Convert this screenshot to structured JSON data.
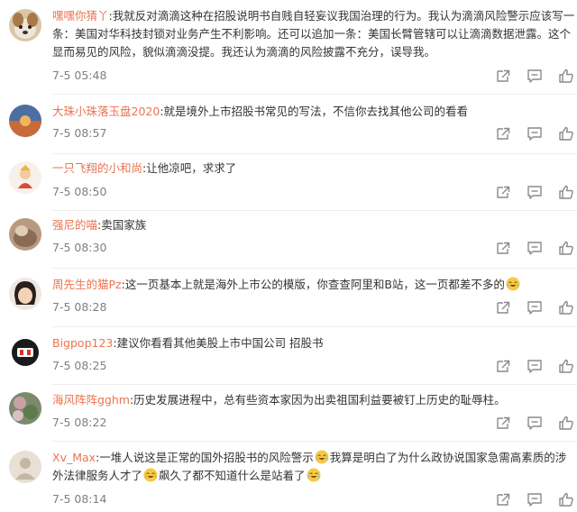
{
  "comments": [
    {
      "username": "嘿嘿你猜丫",
      "lines": [
        ":我就反对滴滴这种在招股说明书自贱自轻妄议我国治理的行为。我认为滴滴风险警示应该写一",
        "条：美国对华科技封锁对业务产生不利影响。还可以追加一条：美国长臂管辖可以让滴滴数据泄露。这个",
        "显而易见的风险，貌似滴滴没提。我还认为滴滴的风险披露不充分，误导我。"
      ],
      "time": "7-5 05:48"
    },
    {
      "username": "大珠小珠落玉盘2020",
      "text": ":就是境外上市招股书常见的写法，不信你去找其他公司的看看",
      "time": "7-5 08:57"
    },
    {
      "username": "一只飞翔的小和尚",
      "text": ":让他凉吧，求求了",
      "time": "7-5 08:50"
    },
    {
      "username": "强尼的喵",
      "text": ":卖国家族",
      "time": "7-5 08:30"
    },
    {
      "username": "周先生的猫Pz",
      "text": ":这一页基本上就是海外上市公的模版，你查查阿里和B站，这一页都差不多的",
      "time": "7-5 08:28"
    },
    {
      "username": "Bigpop123",
      "text": ":建议你看看其他美股上市中国公司 招股书",
      "time": "7-5 08:25"
    },
    {
      "username": "海风阵阵gghm",
      "text": ":历史发展进程中，总有些资本家因为出卖祖国利益要被钉上历史的耻辱柱。",
      "time": "7-5 08:22"
    },
    {
      "username": "Xv_Max",
      "line1": ":一堆人说这是正常的国外招股书的风险警示",
      "line1b": "我算是明白了为什么政协说国家急需高素质的涉",
      "line2a": "外法律服务人才了",
      "line2b": "飙久了都不知道什么是站着了",
      "time": "7-5 08:14"
    }
  ],
  "icons": [
    "share-icon",
    "comment-icon",
    "like-icon"
  ],
  "colors": {
    "username": "#eb7350",
    "meta": "#808080",
    "text": "#333333",
    "divider": "#eeeeee"
  }
}
